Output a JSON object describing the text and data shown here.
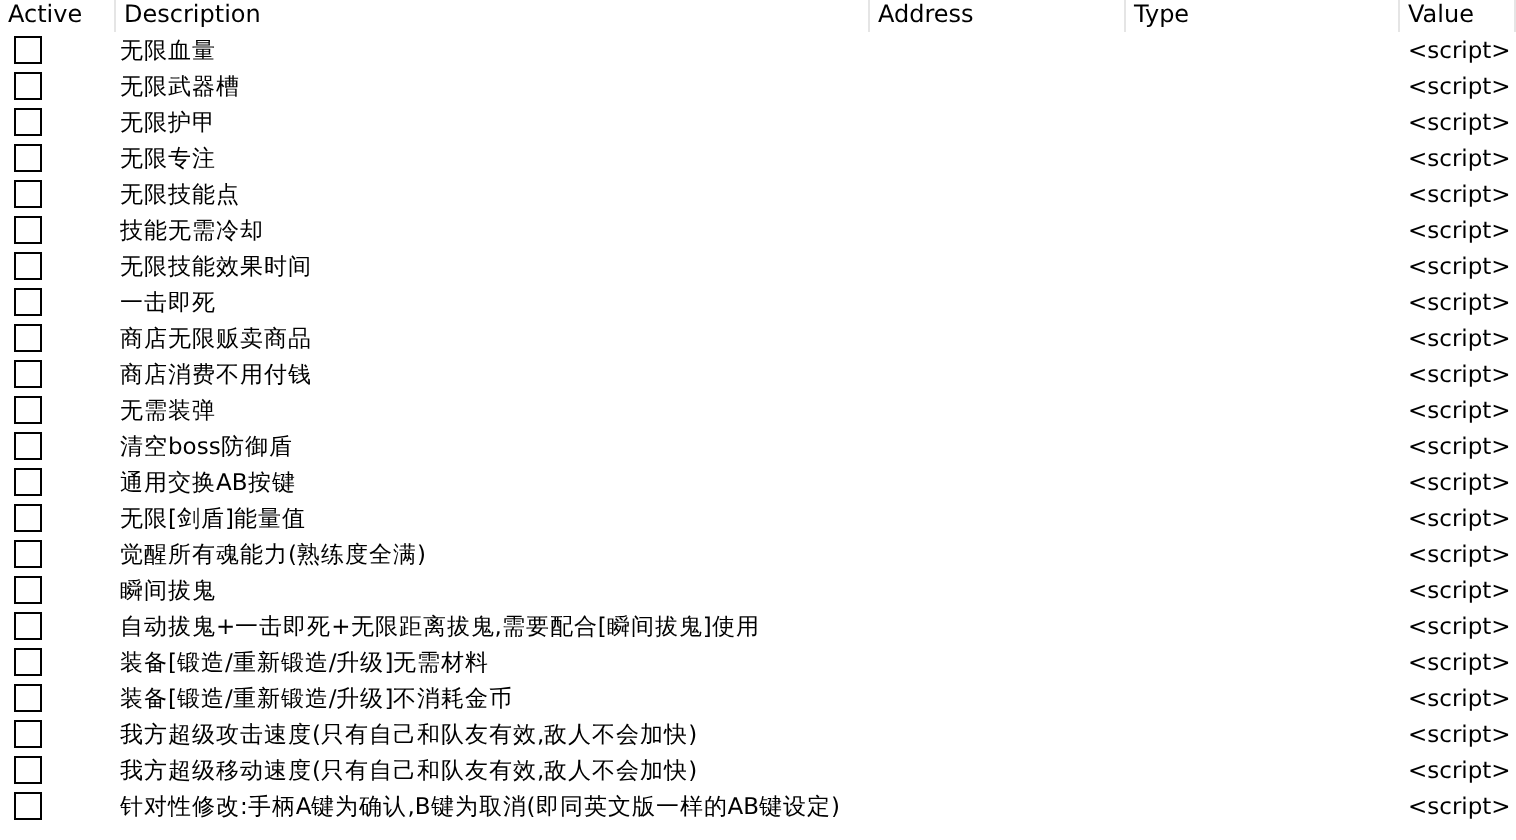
{
  "columns": [
    "Active",
    "Description",
    "Address",
    "Type",
    "Value"
  ],
  "rows": [
    {
      "active": false,
      "description": "无限血量",
      "value": "<script>"
    },
    {
      "active": false,
      "description": "无限武器槽",
      "value": "<script>"
    },
    {
      "active": false,
      "description": "无限护甲",
      "value": "<script>"
    },
    {
      "active": false,
      "description": "无限专注",
      "value": "<script>"
    },
    {
      "active": false,
      "description": "无限技能点",
      "value": "<script>"
    },
    {
      "active": false,
      "description": "技能无需冷却",
      "value": "<script>"
    },
    {
      "active": false,
      "description": "无限技能效果时间",
      "value": "<script>"
    },
    {
      "active": false,
      "description": "一击即死",
      "value": "<script>"
    },
    {
      "active": false,
      "description": "商店无限贩卖商品",
      "value": "<script>"
    },
    {
      "active": false,
      "description": "商店消费不用付钱",
      "value": "<script>"
    },
    {
      "active": false,
      "description": "无需装弹",
      "value": "<script>"
    },
    {
      "active": false,
      "description": "清空boss防御盾",
      "value": "<script>"
    },
    {
      "active": false,
      "description": "通用交换AB按键",
      "value": "<script>"
    },
    {
      "active": false,
      "description": "无限[剑盾]能量值",
      "value": "<script>"
    },
    {
      "active": false,
      "description": "觉醒所有魂能力(熟练度全满)",
      "value": "<script>"
    },
    {
      "active": false,
      "description": "瞬间拔鬼",
      "value": "<script>"
    },
    {
      "active": false,
      "description": "自动拔鬼+一击即死+无限距离拔鬼,需要配合[瞬间拔鬼]使用",
      "value": "<script>"
    },
    {
      "active": false,
      "description": "装备[锻造/重新锻造/升级]无需材料",
      "value": "<script>"
    },
    {
      "active": false,
      "description": "装备[锻造/重新锻造/升级]不消耗金币",
      "value": "<script>"
    },
    {
      "active": false,
      "description": "我方超级攻击速度(只有自己和队友有效,敌人不会加快)",
      "value": "<script>"
    },
    {
      "active": false,
      "description": "我方超级移动速度(只有自己和队友有效,敌人不会加快)",
      "value": "<script>"
    },
    {
      "active": false,
      "description": "针对性修改:手柄A键为确认,B键为取消(即同英文版一样的AB键设定)",
      "value": "<script>"
    }
  ]
}
